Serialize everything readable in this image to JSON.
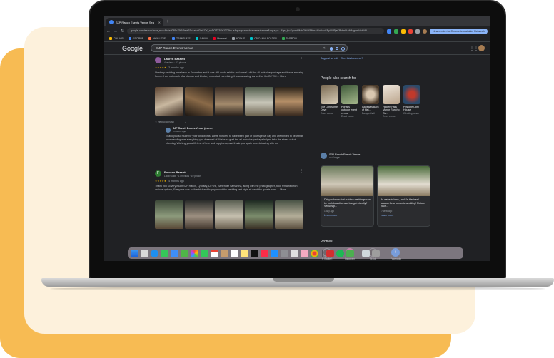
{
  "browser": {
    "tab_title": "SJP Ranch Events Venue Sea",
    "url": "google.com/search?sca_esv=8b4e2085c75f1f5ebf63c&ei=6DeCCY_anDOTY5DCGC6tw-ls&q=sjp+ranch+events+venue&oq=sjp+...&gs_lp=Egxnd3Mtd2l6LXNlcnAiFnNqcCByYW5jaCBldmVudHMgdmVudWU",
    "relaunch_label": "New version for Chrome is available. Relaunch",
    "bookmarks": [
      "CHLBAR",
      "CS DRUP",
      "HIGH LEVEL",
      "TRANSLATE",
      "CANVA",
      "Pinterest",
      "MODUS",
      "CB CANVA FOLDER",
      "DVBROW"
    ]
  },
  "google": {
    "logo": "Google",
    "query": "SJP Ranch Events Venue"
  },
  "reviews": [
    {
      "name": "Lauren Bassett",
      "meta": "4 reviews · 13 photos",
      "stars": "★★★★★",
      "ago": "3 months ago",
      "text": "I had my wedding here back in December and it was all I could ask for and more! I did the all inclusive package and it was amazing for me. I am not much of a planner and Lindsey executed everything, it was amazing! As well as the DJ Will ... More",
      "action": "Helpful to Kristi"
    },
    {
      "name": "Frances Bassett",
      "meta": "Local Guide · 17 reviews · 10 photos",
      "stars": "★★★★★",
      "ago": "4 months ago",
      "text": "Thank you so very much SJP Ranch, Lyndsey, DJ Will, Bartender Samantha, along with the photographer, food remained rich various options, Everyone was so thankful and happy about the wedding last night all went the guests were ... More"
    }
  ],
  "owner_response": {
    "name": "SJP Ranch Events Venue (owner)",
    "ago": "3 months ago",
    "text": "Thank you so much for your kind words! We're honored to have been part of your special day and are thrilled to hear that your wedding was everything you dreamed of. We're so glad the all-inclusive package helped take the stress out of planning. Wishing you a lifetime of love and happiness, and thank you again for celebrating with us!"
  },
  "sidebar": {
    "suggest_edit": "Suggest an edit",
    "own_business": "Own this business?",
    "people_also_search_title": "People also search for",
    "people_also_search": [
      {
        "name": "The Lonesome Dove",
        "type": "Event venue"
      },
      {
        "name": "Portal's outdoor event venue",
        "type": "Event venue"
      },
      {
        "name": "Isabella's Barn of Hel...",
        "type": "Banquet hall"
      },
      {
        "name": "Hidden Falls Manor Rancho Ga...",
        "type": "Event venue"
      },
      {
        "name": "Postorie Opry House",
        "type": "Wedding venue"
      }
    ],
    "updates_name": "SJP Ranch Events Venue",
    "updates_source": "on Google",
    "posts": [
      {
        "text": "Did you know that outdoor weddings can be both beautiful and budget-friendly? Venues p...",
        "ago": "1 day ago",
        "link": "Learn more"
      },
      {
        "text": "As we're in here, and it's the ideal season for a romantic wedding! Picture your...",
        "ago": "1 week ago",
        "link": "Learn more"
      }
    ],
    "profiles_title": "Profiles",
    "profiles": [
      {
        "label": "X (Twitter)",
        "glyph": "X",
        "color": "#000000"
      },
      {
        "label": "Instagram",
        "glyph": "◎",
        "color": "#c13584"
      },
      {
        "label": "TikTok",
        "glyph": "♪",
        "color": "#111111"
      },
      {
        "label": "Facebook",
        "glyph": "f",
        "color": "#1877f2"
      }
    ]
  },
  "colors": {
    "accent_orange": "#f7bb53",
    "cream": "#fdf1dc",
    "google_dark_bg": "#202124",
    "link_blue": "#8ab4f8",
    "star_yellow": "#fbbc04"
  }
}
